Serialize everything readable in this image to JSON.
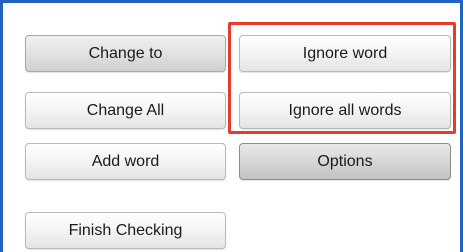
{
  "buttons": {
    "change_to": "Change to",
    "change_all": "Change All",
    "add_word": "Add word",
    "finish_checking": "Finish Checking",
    "ignore_word": "Ignore word",
    "ignore_all_words": "Ignore all words",
    "options": "Options"
  },
  "colors": {
    "frame_border": "#1f64c0",
    "highlight": "#ea3b2a"
  }
}
